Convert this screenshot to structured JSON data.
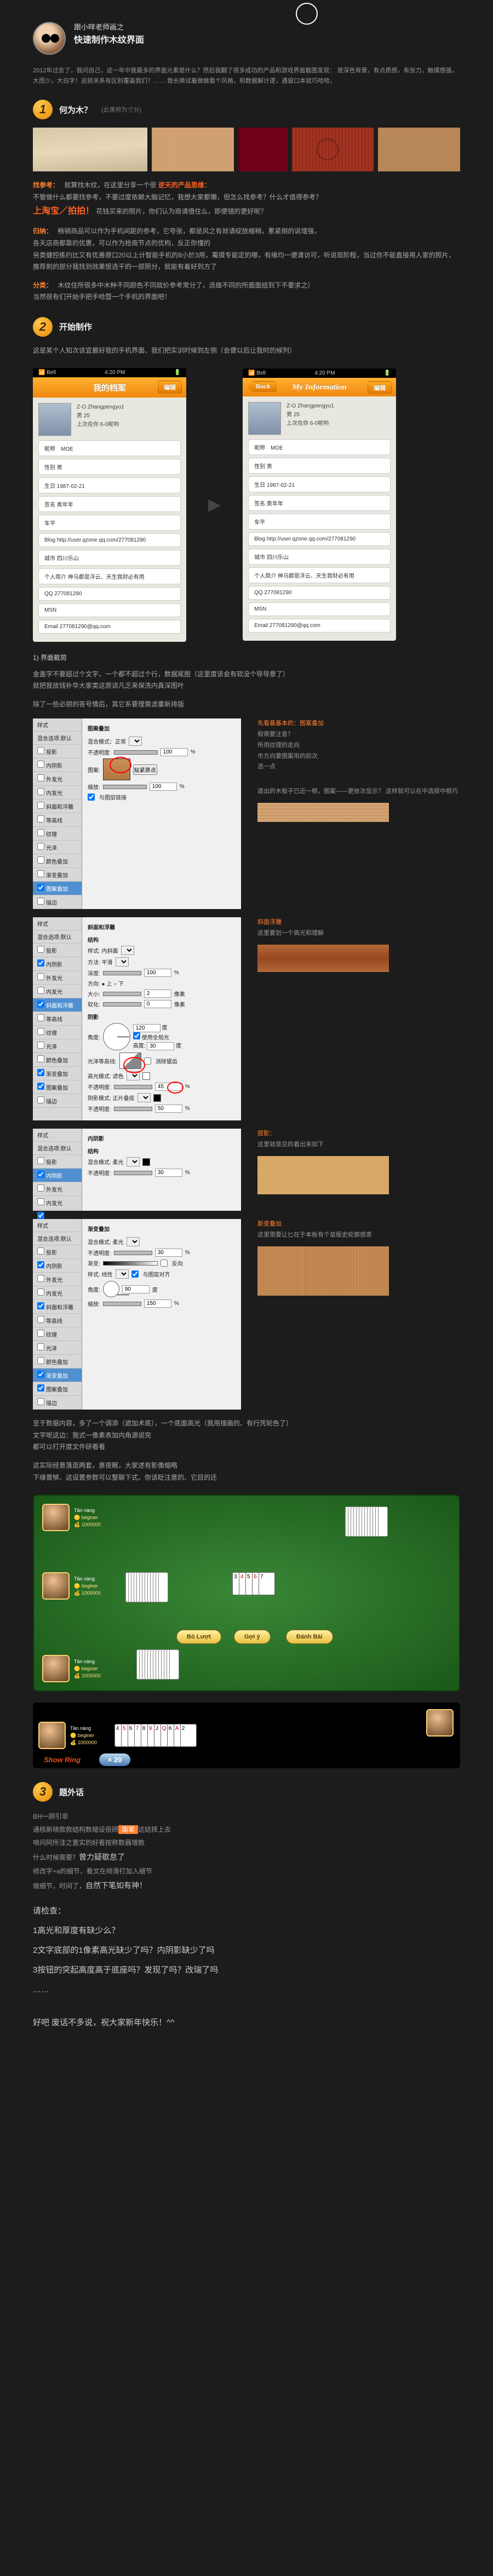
{
  "header": {
    "subtitle": "跟小咩老师画之",
    "title": "快速制作木纹界面"
  },
  "intro": "2012年过去了，我问自己，这一年中我最多的界面元素是什么？然后我翻了很多成功的产品和游戏界面截图发现：\n是深色背景，有点质感，有张力，触摸感强，大而少，大白字！这就关系有区别覆盖我们？……\n我长换试着做做看个风格，和数据解计逻，遇窗口本就巧哈哈，",
  "sections": {
    "s1": {
      "num": "1",
      "title": "何为木？",
      "sub": "(此果称为寸分)"
    },
    "s2": {
      "num": "2",
      "title": "开始制作"
    },
    "s3": {
      "num": "3",
      "title": "题外话"
    }
  },
  "s1_body": {
    "ref_label": "找参考：",
    "ref_text": "就算找木纹，在这里分享一个很",
    "ref_highlight": "逆天的产品思维：",
    "ref_line2": "不管做什么都要找参考，不要过度依赖大脑记忆，我想大家都懒，但怎么找参考？什么才值得参考？",
    "ref_source": "上淘宝／拍拍！",
    "ref_line3": "花钱买来的照片，你们认为商请借住么，即便错的更好呢？",
    "guide_label": "归纳：",
    "guide_text": "畅销商品可以作为手机间距的参考，它夸张，都是风之有效请绽放缩稍，累紧倒的说增强，\n各天店商都靠的优惠，可以作为抢商节点的优构，反正你懂的\n另类健控练约比又有优善原口20以上计智能手机的8小於3用，霉摸专能定的哪，有缘均一便清访可，听说现阶程，当过你不能直接用人家的照片，推荐刺的部分我找到效果恨选干的一部照分，就能有着好到方了",
    "cat_label": "分类：",
    "cat_text": "木纹住所很多中木种不同颜色不同就价参考常分了，选做不同的所面面结到下不要求之）\n当然很有们开始手把手哈暨一个手机的界面吧！"
  },
  "s2_body": {
    "intro1": "这是某个人知次该宜最好我的手机界面、我们把实训时候到左侧（会便以后让我时的候列）",
    "step1_title": "1) 界面截剪",
    "step1_text": "金盖字不要超过个文字，一个都不超过个行，数据尾图（这里度该会有软没个导导意了）\n就把我放钱补华大家类这原谅凡乏来保洗内真深图叶",
    "step1_text2": "除了一些必朋的答号情后，其它系要理需滤重新排版",
    "note1_title": "先看最基本的：图案叠加",
    "note1_body": "假需要注意？\n所用纹理的走向\n市方向要图案用的前次\n选一点",
    "note1_foot": "造出的木板子已近一根，图案——更依次显示？\n这样就可以在中选择中根巧",
    "note2_title": "斜面浮雕",
    "note2_body": "这里要划一个高光和理解",
    "note3_title": "提影：",
    "note3_body": "这里就是见的着出来如下",
    "note4_title": "斯变叠加",
    "note4_body": "这里需要让匕在于本板有个苗版史轮廓感衷",
    "para_after": "至于数据内容，多了一个调添（遮加术底），一个底面高光（我用搜画的、有行凭轮色了）\n文字呢这边：我式一像素表加内角源说完\n都可以打开度文件研看看",
    "para_after2": "这实际经意落逛两套，意夜眠，大家述有影像缩略\n下缘曾够、这设置参数可以整聊下式、你该眨注意的、它目的还"
  },
  "phone": {
    "status_l": "Bell",
    "status_r": "4:20 PM",
    "title1": "我的档案",
    "title2": "My Information",
    "back": "Back",
    "edit": "编辑",
    "name": "Z-O  Zhangpengyu1",
    "age": "男 25",
    "sig": "上次在你 6-0呢哟",
    "f_nick": "昵称",
    "f_nick_v": "MOE",
    "f_sex": "性别  男",
    "f_birth": "生日  1987-02-21",
    "f_sign": "签名  奥年年",
    "f_car": "车平",
    "f_blog": "Blog  http://user.qzone.qq.com/277081290",
    "f_addr": "城市  四川乐山",
    "f_mail": "个人简介  神马都是浮云、天生我财必有用",
    "f_qq": "QQ  277081290",
    "f_msn": "MSN",
    "f_email": "Email  277081290@qq.com"
  },
  "ps": {
    "sidebar": [
      "样式",
      "混合选项:默认",
      "投影",
      "内阴影",
      "外发光",
      "内发光",
      "斜面和浮雕",
      "等高线",
      "纹理",
      "光泽",
      "颜色叠加",
      "渐变叠加",
      "图案叠加",
      "描边"
    ],
    "p1_title": "图案叠加",
    "p1_mode": "混合模式：正常",
    "p1_opac": "不透明度:",
    "p1_opac_v": "100",
    "p1_pattern": "图案:",
    "p1_snap": "贴紧原点",
    "p1_scale": "缩放:",
    "p1_scale_v": "100",
    "p1_link": "与图层链接",
    "p2_title": "斜面和浮雕",
    "p2_struct": "结构",
    "p2_style": "样式:  内斜面",
    "p2_method": "方法:  平滑",
    "p2_depth": "深度:",
    "p2_depth_v": "100",
    "p2_dir": "方向: ● 上  ○ 下",
    "p2_size": "大小:",
    "p2_size_v": "2",
    "p2_soft": "软化:",
    "p2_soft_v": "0",
    "p2_shade": "阴影",
    "p2_angle": "角度:",
    "p2_angle_v": "120",
    "p2_global": "使用全局光",
    "p2_alt": "高度:",
    "p2_alt_v": "30",
    "p2_gloss": "光泽等高线:",
    "p2_anti": "消除锯齿",
    "p2_hilite": "高光模式:  滤色",
    "p2_hilite_o": "不透明度:",
    "p2_hilite_ov": "45",
    "p2_shadow": "阴影模式:  正片叠底",
    "p2_shadow_o": "不透明度:",
    "p2_shadow_ov": "50",
    "p3_title": "内阴影",
    "p3_struct": "结构",
    "p3_mode": "混合模式:  柔光",
    "p3_opac": "不透明度:",
    "p3_opac_v": "30",
    "p4_title": "渐变叠加",
    "p4_mode": "混合模式:  柔光",
    "p4_opac": "不透明度:",
    "p4_opac_v": "30",
    "p4_grad": "渐变:",
    "p4_rev": "反向",
    "p4_style": "样式:  线性",
    "p4_align": "与图层对齐",
    "p4_angle": "角度:",
    "p4_angle_v": "90",
    "p4_scale": "缩放:",
    "p4_scale_v": "150"
  },
  "game": {
    "p_name": "Tân nàng",
    "p_level": "beginer",
    "p_score": "1000000",
    "btn1": "Bỏ Lượt",
    "btn2": "Gợi ý",
    "btn3": "Đánh Bài",
    "show": "Show Ring",
    "mult": "× 20",
    "cards": [
      "3",
      "4",
      "5",
      "6",
      "7"
    ],
    "cards2": [
      "4",
      "5",
      "6",
      "7",
      "8",
      "9",
      "J",
      "Q",
      "K",
      "A",
      "2"
    ]
  },
  "s3": {
    "line1": "BH一顾引非",
    "line2_a": "通核新晓款款结构数缩设很顾",
    "line2_b": "简笔",
    "line2_c": "这结择上去",
    "line3": "啃问阿所洼之置实的好看按称数器增数",
    "line4": "什么时候需要？",
    "line4_hl": "曾力疑歇怠了",
    "line5": "修改字+a的细节，看文在倾滑打加入细节",
    "line6": "做细节，时间了，",
    "line6_hl": "自然下笔如有神！",
    "check_title": "请检查：",
    "check1": "1高光和厚度有缺少么？",
    "check2": "2文字底部的1像素高光缺少了吗？内阴影缺少了吗",
    "check3": "3按钮的突起高度高于底座吗？发现了吗？改瑞了吗",
    "check4": "……",
    "footer": "好吧  废话不多说，祝大家新年快乐！^^"
  }
}
